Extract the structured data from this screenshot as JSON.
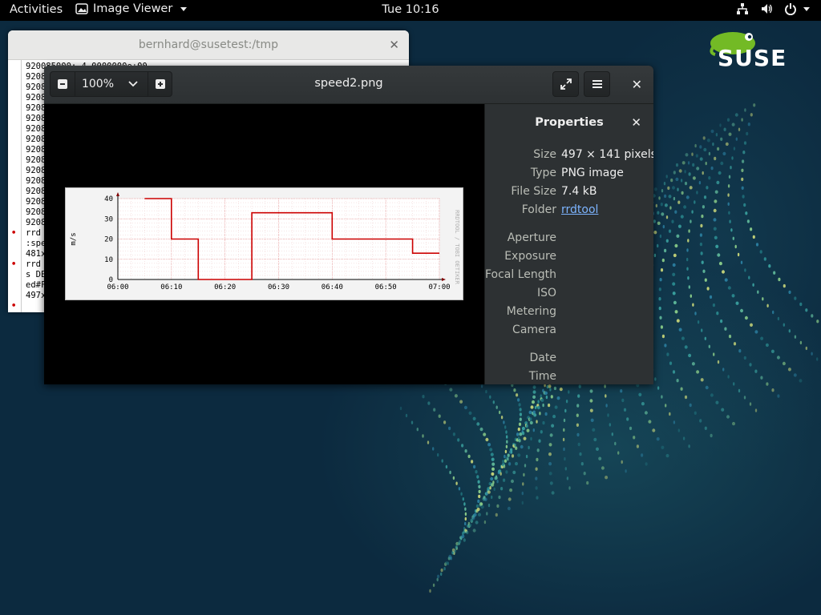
{
  "topbar": {
    "activities": "Activities",
    "app_menu": "Image Viewer",
    "clock": "Tue 10:16"
  },
  "logo": {
    "text": "SUSE"
  },
  "terminal": {
    "title": "bernhard@susetest:/tmp",
    "lines": [
      "920085000: 4.0000000e+00",
      "9208",
      "9208",
      "9208",
      "9208",
      "9208",
      "9208",
      "9208",
      "9208",
      "9208",
      "9208",
      "9208",
      "9208",
      "9208",
      "9208",
      "9208",
      "rrd",
      ":spe",
      "481x",
      "rrd",
      "s DE",
      "ed#F",
      "497x",
      ""
    ]
  },
  "viewer": {
    "title": "speed2.png",
    "zoom": "100%",
    "properties": {
      "heading": "Properties",
      "rows": [
        {
          "key": "Size",
          "value": "497 × 141 pixels"
        },
        {
          "key": "Type",
          "value": "PNG image"
        },
        {
          "key": "File Size",
          "value": "7.4 kB"
        },
        {
          "key": "Folder",
          "value": "rrdtool"
        },
        {
          "key": "Aperture",
          "value": ""
        },
        {
          "key": "Exposure",
          "value": ""
        },
        {
          "key": "Focal Length",
          "value": ""
        },
        {
          "key": "ISO",
          "value": ""
        },
        {
          "key": "Metering",
          "value": ""
        },
        {
          "key": "Camera",
          "value": ""
        },
        {
          "key": "Date",
          "value": ""
        },
        {
          "key": "Time",
          "value": ""
        }
      ]
    }
  },
  "chart_data": {
    "type": "line",
    "title": "",
    "ylabel": "m/s",
    "watermark": "RRDTOOL / TOBI OETIKER",
    "x_ticks": [
      "06:00",
      "06:10",
      "06:20",
      "06:30",
      "06:40",
      "06:50",
      "07:00"
    ],
    "y_ticks": [
      "0",
      "10",
      "20",
      "30",
      "40"
    ],
    "ylim": [
      0,
      40
    ],
    "xlim_minutes": [
      0,
      60
    ],
    "series": [
      {
        "color": "#cc0000",
        "step_points": [
          {
            "t": 5,
            "v": 40
          },
          {
            "t": 10,
            "v": 40
          },
          {
            "t": 10,
            "v": 20
          },
          {
            "t": 15,
            "v": 20
          },
          {
            "t": 15,
            "v": 0
          },
          {
            "t": 25,
            "v": 0
          },
          {
            "t": 25,
            "v": 33
          },
          {
            "t": 40,
            "v": 33
          },
          {
            "t": 40,
            "v": 20
          },
          {
            "t": 55,
            "v": 20
          },
          {
            "t": 55,
            "v": 13
          },
          {
            "t": 60,
            "v": 13
          }
        ]
      }
    ]
  }
}
